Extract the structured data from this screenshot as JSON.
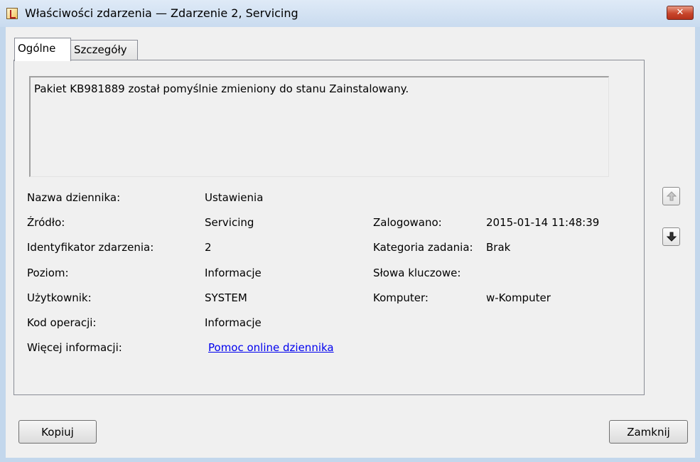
{
  "window": {
    "title": "Właściwości zdarzenia — Zdarzenie 2, Servicing",
    "close_label": "✕"
  },
  "tabs": [
    {
      "label": "Ogólne",
      "selected": true
    },
    {
      "label": "Szczegóły",
      "selected": false
    }
  ],
  "message": "Pakiet KB981889 został pomyślnie zmieniony do stanu Zainstalowany.",
  "fields": {
    "log_name": {
      "label": "Nazwa dziennika:",
      "value": "Ustawienia"
    },
    "source": {
      "label": "Źródło:",
      "value": "Servicing"
    },
    "event_id": {
      "label": "Identyfikator zdarzenia:",
      "value": "2"
    },
    "level": {
      "label": "Poziom:",
      "value": "Informacje"
    },
    "user": {
      "label": "Użytkownik:",
      "value": "SYSTEM"
    },
    "opcode": {
      "label": "Kod operacji:",
      "value": "Informacje"
    },
    "more_info": {
      "label": "Więcej informacji:",
      "value": "Pomoc online dziennika"
    },
    "logged": {
      "label": "Zalogowano:",
      "value": "2015-01-14 11:48:39"
    },
    "task_category": {
      "label": "Kategoria zadania:",
      "value": "Brak"
    },
    "keywords": {
      "label": "Słowa kluczowe:",
      "value": ""
    },
    "computer": {
      "label": "Komputer:",
      "value": "w-Komputer"
    }
  },
  "buttons": {
    "copy": "Kopiuj",
    "close": "Zamknij"
  },
  "icons": {
    "app": "event-viewer-icon",
    "up": "arrow-up-icon",
    "down": "arrow-down-icon"
  }
}
